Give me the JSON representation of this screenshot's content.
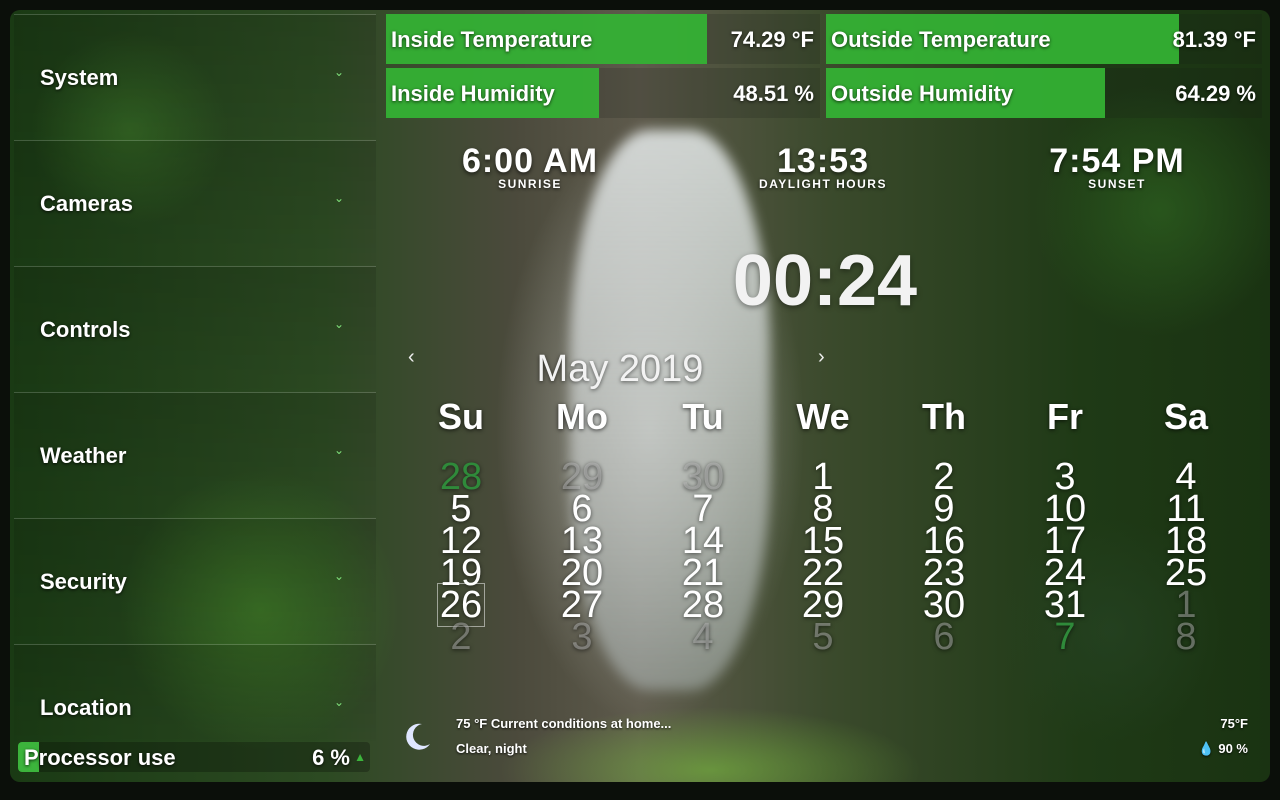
{
  "sidebar": {
    "items": [
      {
        "label": "System"
      },
      {
        "label": "Cameras"
      },
      {
        "label": "Controls"
      },
      {
        "label": "Weather"
      },
      {
        "label": "Security"
      },
      {
        "label": "Location"
      }
    ]
  },
  "processor": {
    "label": "Processor use",
    "value": "6 %",
    "percent": 6
  },
  "sensors": {
    "inside_temp": {
      "label": "Inside Temperature",
      "value": "74.29 °F",
      "fill_percent": 74
    },
    "outside_temp": {
      "label": "Outside Temperature",
      "value": "81.39 °F",
      "fill_percent": 81
    },
    "inside_humidity": {
      "label": "Inside Humidity",
      "value": "48.51 %",
      "fill_percent": 49
    },
    "outside_humidity": {
      "label": "Outside Humidity",
      "value": "64.29 %",
      "fill_percent": 64
    }
  },
  "sun": {
    "sunrise": {
      "time": "6:00 AM",
      "label": "SUNRISE"
    },
    "daylight": {
      "time": "13:53",
      "label": "DAYLIGHT HOURS"
    },
    "sunset": {
      "time": "7:54 PM",
      "label": "SUNSET"
    }
  },
  "clock": {
    "time": "00:24"
  },
  "calendar": {
    "title": "May 2019",
    "prev": "‹",
    "next": "›",
    "weekdays": [
      "Su",
      "Mo",
      "Tu",
      "We",
      "Th",
      "Fr",
      "Sa"
    ],
    "weeks": [
      [
        {
          "d": "28",
          "t": "green"
        },
        {
          "d": "29",
          "t": "other"
        },
        {
          "d": "30",
          "t": "other"
        },
        {
          "d": "1"
        },
        {
          "d": "2"
        },
        {
          "d": "3"
        },
        {
          "d": "4"
        }
      ],
      [
        {
          "d": "5"
        },
        {
          "d": "6"
        },
        {
          "d": "7"
        },
        {
          "d": "8"
        },
        {
          "d": "9"
        },
        {
          "d": "10"
        },
        {
          "d": "11"
        }
      ],
      [
        {
          "d": "12"
        },
        {
          "d": "13"
        },
        {
          "d": "14"
        },
        {
          "d": "15"
        },
        {
          "d": "16"
        },
        {
          "d": "17"
        },
        {
          "d": "18"
        }
      ],
      [
        {
          "d": "19"
        },
        {
          "d": "20"
        },
        {
          "d": "21"
        },
        {
          "d": "22"
        },
        {
          "d": "23"
        },
        {
          "d": "24"
        },
        {
          "d": "25"
        }
      ],
      [
        {
          "d": "26",
          "t": "today"
        },
        {
          "d": "27"
        },
        {
          "d": "28"
        },
        {
          "d": "29"
        },
        {
          "d": "30"
        },
        {
          "d": "31"
        },
        {
          "d": "1",
          "t": "other"
        }
      ],
      [
        {
          "d": "2",
          "t": "other"
        },
        {
          "d": "3",
          "t": "other"
        },
        {
          "d": "4",
          "t": "other"
        },
        {
          "d": "5",
          "t": "other"
        },
        {
          "d": "6",
          "t": "other"
        },
        {
          "d": "7",
          "t": "green"
        },
        {
          "d": "8",
          "t": "other"
        }
      ]
    ]
  },
  "weather": {
    "icon": "moon-icon",
    "summary": "75 °F Current conditions at home...",
    "condition": "Clear, night",
    "temp": "75°F",
    "humidity": "90 %"
  },
  "colors": {
    "accent": "#3cb43c",
    "sensor_fill": "#34b434"
  }
}
